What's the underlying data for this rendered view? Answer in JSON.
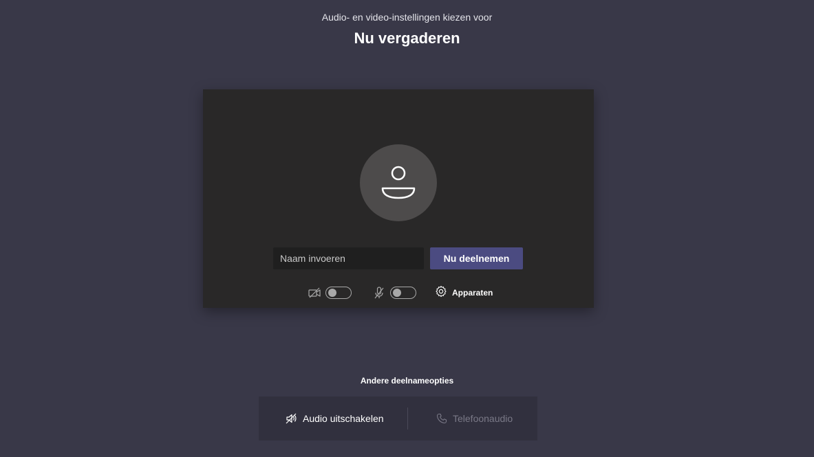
{
  "header": {
    "subtitle": "Audio- en video-instellingen kiezen voor",
    "title": "Nu vergaderen"
  },
  "preview": {
    "avatar_icon": "person-icon",
    "name_placeholder": "Naam invoeren",
    "join_label": "Nu deelnemen",
    "video_toggle": {
      "icon": "camera-off-icon",
      "state": "off"
    },
    "mic_toggle": {
      "icon": "mic-off-icon",
      "state": "off"
    },
    "devices_label": "Apparaten",
    "devices_icon": "gear-icon"
  },
  "other_options": {
    "label": "Andere deelnameopties",
    "audio_off_label": "Audio uitschakelen",
    "audio_off_icon": "speaker-off-icon",
    "phone_audio_label": "Telefoonaudio",
    "phone_audio_icon": "phone-icon"
  },
  "colors": {
    "background": "#393848",
    "card": "#292828",
    "accent": "#4b4b81"
  }
}
